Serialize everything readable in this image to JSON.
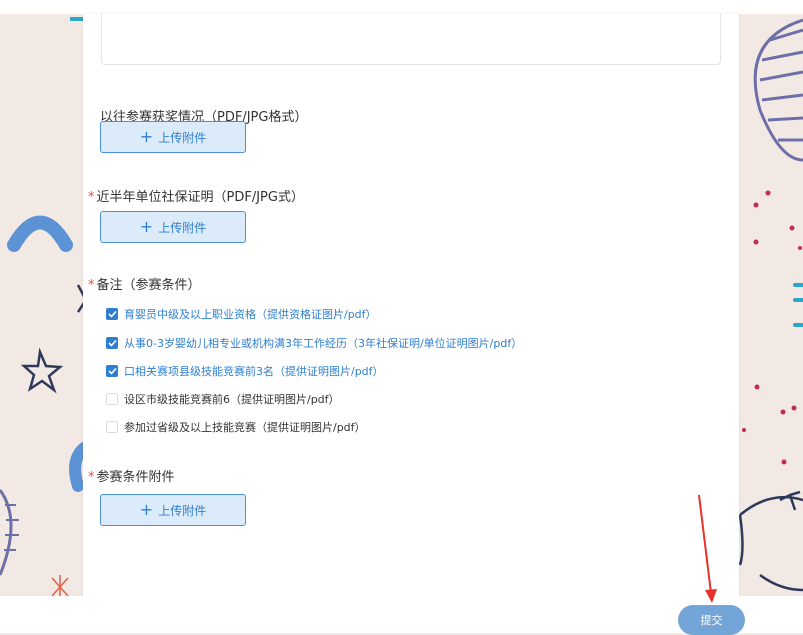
{
  "sections": {
    "past_awards": {
      "label": "以往参赛获奖情况（PDF/JPG格式）",
      "required": false,
      "upload_label": "上传附件"
    },
    "social_security": {
      "label": "近半年单位社保证明（PDF/JPG式）",
      "required": true,
      "upload_label": "上传附件"
    },
    "remarks": {
      "label": "备注（参赛条件）",
      "required": true,
      "options": [
        {
          "label": "育婴员中级及以上职业资格（提供资格证图片/pdf）",
          "checked": true
        },
        {
          "label": "从事0-3岁婴幼儿相专业或机构满3年工作经历（3年社保证明/单位证明图片/pdf）",
          "checked": true
        },
        {
          "label": "口相关赛项县级技能竞赛前3名（提供证明图片/pdf）",
          "checked": true
        },
        {
          "label": "设区市级技能竞赛前6（提供证明图片/pdf）",
          "checked": false
        },
        {
          "label": "参加过省级及以上技能竞赛（提供证明图片/pdf）",
          "checked": false
        }
      ]
    },
    "condition_attachment": {
      "label": "参赛条件附件",
      "required": true,
      "upload_label": "上传附件"
    }
  },
  "submit_label": "提交",
  "colors": {
    "accent": "#2f7fd0",
    "required": "#f04b4b",
    "annotation_arrow": "#e8312a"
  }
}
